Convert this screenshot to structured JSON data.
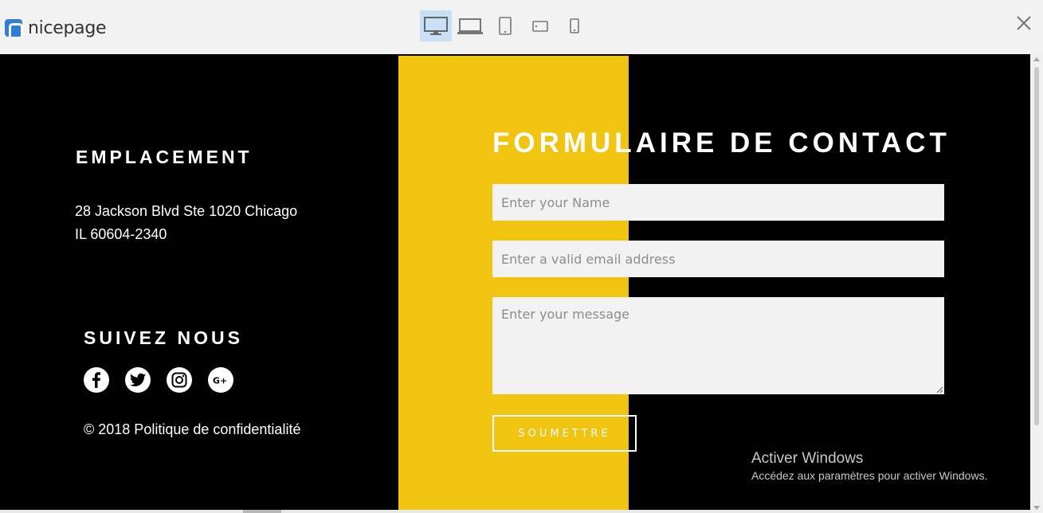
{
  "app": {
    "logo_text": "nicepage",
    "devices": [
      {
        "icon": "desktop-icon",
        "active": true
      },
      {
        "icon": "laptop-icon",
        "active": false
      },
      {
        "icon": "tablet-portrait-icon",
        "active": false
      },
      {
        "icon": "tablet-landscape-icon",
        "active": false
      },
      {
        "icon": "phone-icon",
        "active": false
      }
    ],
    "active_color": "#c8e0f6",
    "brand_color": "#2f7fd6"
  },
  "location": {
    "heading": "EMPLACEMENT",
    "address_line1": "28 Jackson Blvd Ste 1020 Chicago",
    "address_line2": "IL 60604-2340"
  },
  "social": {
    "heading": "SUIVEZ NOUS",
    "icons": [
      "facebook-icon",
      "twitter-icon",
      "instagram-icon",
      "google-plus-icon"
    ]
  },
  "footer": {
    "copyright": "© 2018 Politique de confidentialité"
  },
  "contact_form": {
    "heading": "FORMULAIRE DE CONTACT",
    "name_placeholder": "Enter your Name",
    "email_placeholder": "Enter a valid email address",
    "message_placeholder": "Enter your message",
    "submit_label": "SOUMETTRE",
    "accent_color": "#f1c40f"
  },
  "watermark": {
    "title": "Activer Windows",
    "subtitle": "Accédez aux paramètres pour activer Windows."
  }
}
